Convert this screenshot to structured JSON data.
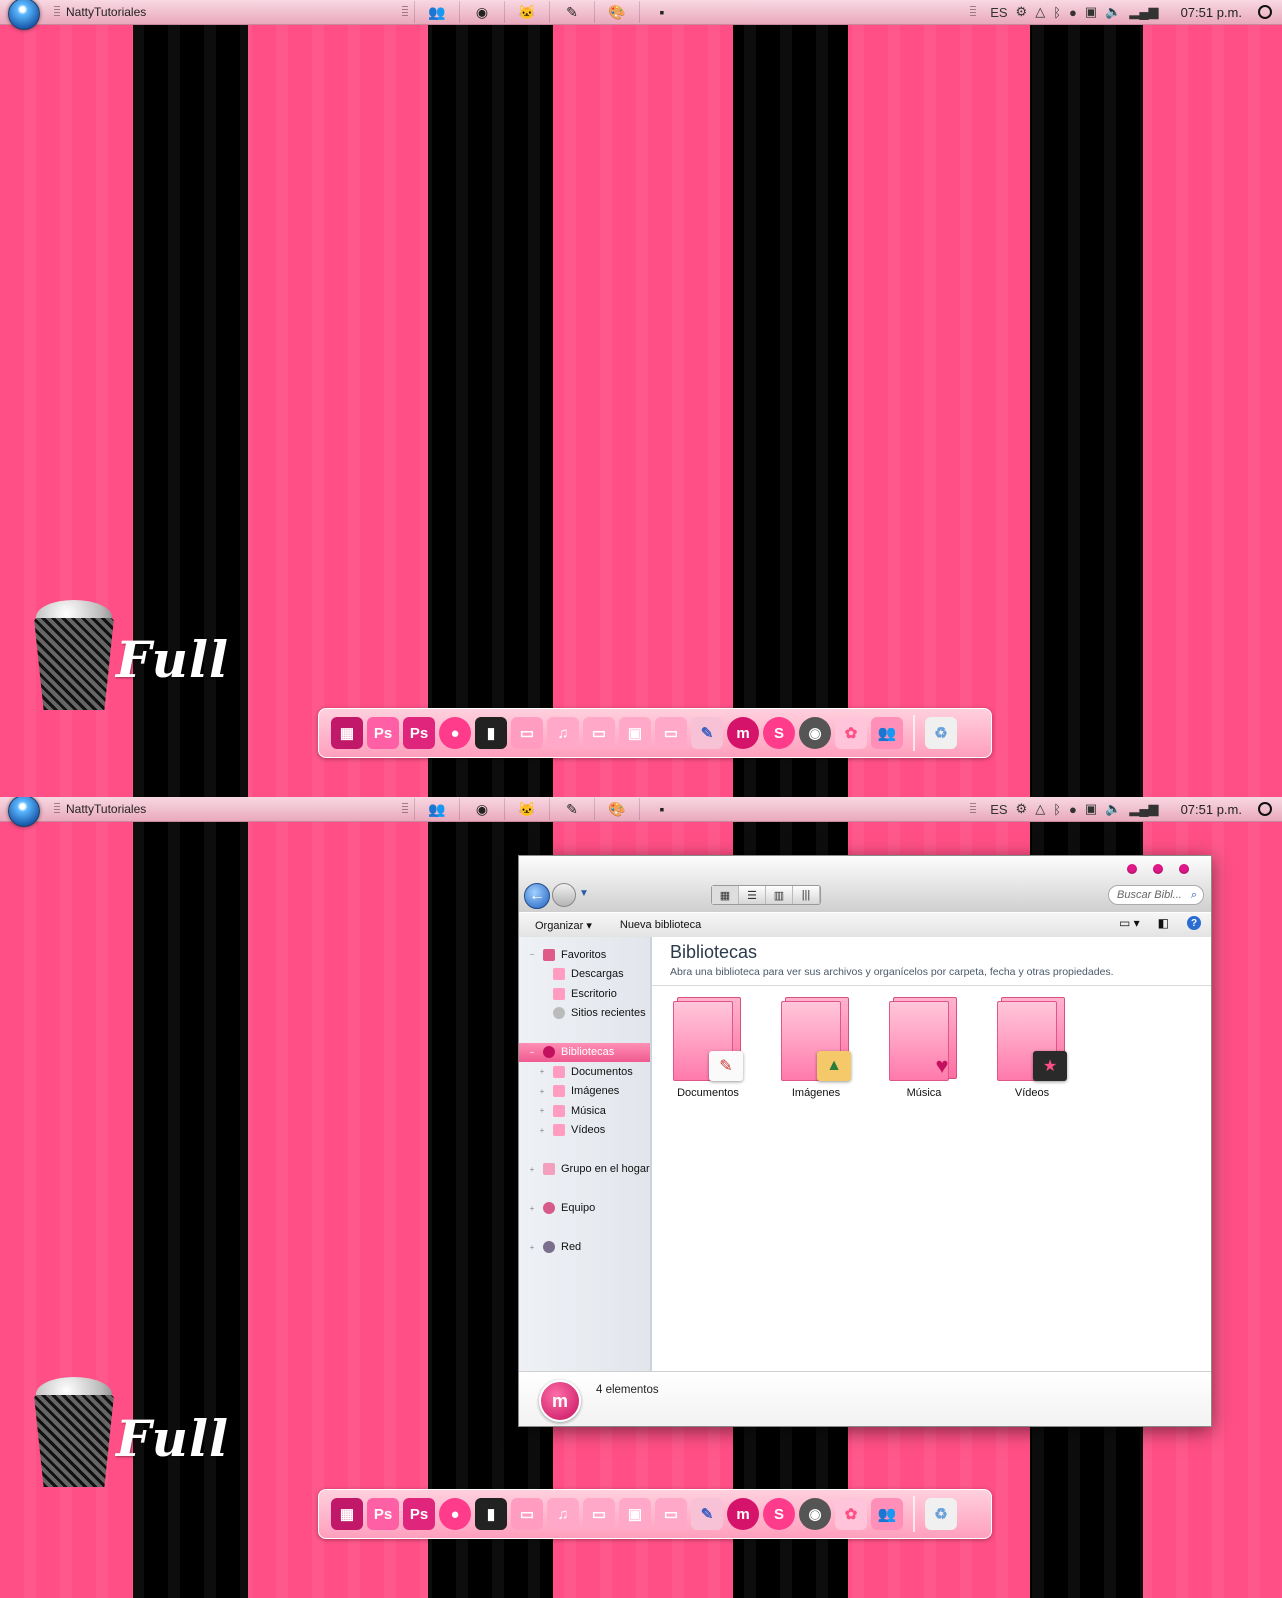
{
  "taskbar": {
    "title": "NattyTutoriales",
    "task_icons": [
      "people-icon",
      "chrome-icon",
      "cat-icon",
      "photoshop-icon",
      "paint-icon",
      "terminal-icon"
    ],
    "language": "ES",
    "clock": "07:51 p.m."
  },
  "desktop": {
    "overlay_text": "Full"
  },
  "dock": {
    "icons": [
      "domo-icon",
      "photoshop-icon",
      "photoshop-alt-icon",
      "webcam-icon",
      "camera-icon",
      "folder-icon",
      "folder-music-icon",
      "folder-icon",
      "folder-pictures-icon",
      "folder-icon",
      "paint-icon",
      "mm-icon",
      "skype-icon",
      "chrome-icon",
      "flower-icon",
      "messenger-icon",
      "recycle-bin-icon"
    ]
  },
  "explorer": {
    "search_placeholder": "Buscar Bibl...",
    "toolbar": {
      "organize": "Organizar",
      "new_library": "Nueva biblioteca"
    },
    "nav": {
      "favorites": "Favoritos",
      "downloads": "Descargas",
      "desktop": "Escritorio",
      "recent": "Sitios recientes",
      "libraries": "Bibliotecas",
      "documents": "Documentos",
      "images": "Imágenes",
      "music": "Música",
      "videos": "Vídeos",
      "homegroup": "Grupo en el hogar",
      "computer": "Equipo",
      "network": "Red"
    },
    "content": {
      "title": "Bibliotecas",
      "subtitle": "Abra una biblioteca para ver sus archivos y organícelos por carpeta, fecha y otras propiedades.",
      "items": [
        {
          "label": "Documentos",
          "icon": "document-icon"
        },
        {
          "label": "Imágenes",
          "icon": "picture-icon"
        },
        {
          "label": "Música",
          "icon": "headphones-icon"
        },
        {
          "label": "Vídeos",
          "icon": "clapperboard-icon"
        }
      ]
    },
    "status": {
      "count": "4 elementos",
      "logo": "m"
    }
  },
  "colors": {
    "pink": "#ff4f86",
    "black": "#000000",
    "accent": "#e2188a"
  }
}
